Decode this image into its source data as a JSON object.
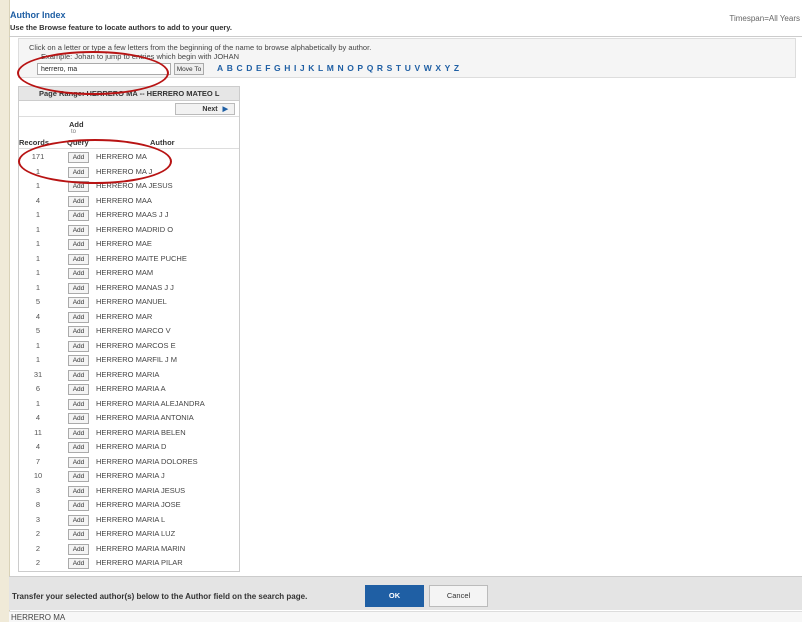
{
  "header": {
    "title": "Author Index",
    "subtitle": "Use the Browse feature to locate authors to add to your query.",
    "timespan": "Timespan=All Years"
  },
  "browse": {
    "instruction": "Click on a letter or type a few letters from the beginning of the name to browse alphabetically by author.",
    "example": "Example: Johan to jump to entries which begin with JOHAN",
    "search_value": "herrero, ma",
    "move_to_label": "Move To",
    "letters": [
      "A",
      "B",
      "C",
      "D",
      "E",
      "F",
      "G",
      "H",
      "I",
      "J",
      "K",
      "L",
      "M",
      "N",
      "O",
      "P",
      "Q",
      "R",
      "S",
      "T",
      "U",
      "V",
      "W",
      "X",
      "Y",
      "Z"
    ]
  },
  "results": {
    "page_range": "Page Range: HERRERO MA -- HERRERO MATEO L",
    "next_label": "Next",
    "col_records": "Records",
    "col_add_1": "Add",
    "col_add_2": "to",
    "col_add_3": "Query",
    "col_author": "Author",
    "add_label": "Add",
    "rows": [
      {
        "records": "171",
        "author": "HERRERO MA"
      },
      {
        "records": "1",
        "author": "HERRERO MA J"
      },
      {
        "records": "1",
        "author": "HERRERO MA JESUS"
      },
      {
        "records": "4",
        "author": "HERRERO MAA"
      },
      {
        "records": "1",
        "author": "HERRERO MAAS J J"
      },
      {
        "records": "1",
        "author": "HERRERO MADRID O"
      },
      {
        "records": "1",
        "author": "HERRERO MAE"
      },
      {
        "records": "1",
        "author": "HERRERO MAITE PUCHE"
      },
      {
        "records": "1",
        "author": "HERRERO MAM"
      },
      {
        "records": "1",
        "author": "HERRERO MANAS J J"
      },
      {
        "records": "5",
        "author": "HERRERO MANUEL"
      },
      {
        "records": "4",
        "author": "HERRERO MAR"
      },
      {
        "records": "5",
        "author": "HERRERO MARCO V"
      },
      {
        "records": "1",
        "author": "HERRERO MARCOS E"
      },
      {
        "records": "1",
        "author": "HERRERO MARFIL J M"
      },
      {
        "records": "31",
        "author": "HERRERO MARIA"
      },
      {
        "records": "6",
        "author": "HERRERO MARIA A"
      },
      {
        "records": "1",
        "author": "HERRERO MARIA ALEJANDRA"
      },
      {
        "records": "4",
        "author": "HERRERO MARIA ANTONIA"
      },
      {
        "records": "11",
        "author": "HERRERO MARIA BELEN"
      },
      {
        "records": "4",
        "author": "HERRERO MARIA D"
      },
      {
        "records": "7",
        "author": "HERRERO MARIA DOLORES"
      },
      {
        "records": "10",
        "author": "HERRERO MARIA J"
      },
      {
        "records": "3",
        "author": "HERRERO MARIA JESUS"
      },
      {
        "records": "8",
        "author": "HERRERO MARIA JOSE"
      },
      {
        "records": "3",
        "author": "HERRERO MARIA L"
      },
      {
        "records": "2",
        "author": "HERRERO MARIA LUZ"
      },
      {
        "records": "2",
        "author": "HERRERO MARIA MARIN"
      },
      {
        "records": "2",
        "author": "HERRERO MARIA PILAR"
      }
    ]
  },
  "footer": {
    "transfer_text": "Transfer your selected author(s) below to the Author field on the search page.",
    "ok_label": "OK",
    "cancel_label": "Cancel",
    "selected_author": "HERRERO MA"
  },
  "colors": {
    "accent": "#1f5fa4",
    "annotation": "#b81313"
  }
}
